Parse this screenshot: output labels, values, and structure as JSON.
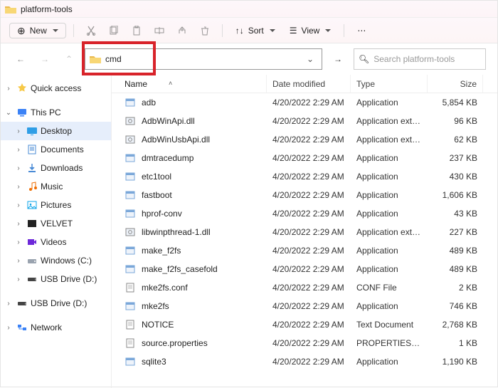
{
  "title": "platform-tools",
  "toolbar": {
    "new": "New",
    "sort": "Sort",
    "view": "View"
  },
  "address": {
    "value": "cmd",
    "search_placeholder": "Search platform-tools"
  },
  "columns": {
    "name": "Name",
    "date": "Date modified",
    "type": "Type",
    "size": "Size"
  },
  "sidebar": [
    {
      "id": "quick",
      "label": "Quick access",
      "icon": "star",
      "expand": ">",
      "indent": 0
    },
    {
      "id": "thispc",
      "label": "This PC",
      "icon": "pc",
      "expand": "v",
      "indent": 0,
      "gapBefore": true
    },
    {
      "id": "desktop",
      "label": "Desktop",
      "icon": "desktop",
      "expand": ">",
      "indent": 1,
      "selected": true
    },
    {
      "id": "documents",
      "label": "Documents",
      "icon": "doc",
      "expand": ">",
      "indent": 1
    },
    {
      "id": "downloads",
      "label": "Downloads",
      "icon": "down",
      "expand": ">",
      "indent": 1
    },
    {
      "id": "music",
      "label": "Music",
      "icon": "music",
      "expand": ">",
      "indent": 1
    },
    {
      "id": "pictures",
      "label": "Pictures",
      "icon": "pic",
      "expand": ">",
      "indent": 1
    },
    {
      "id": "velvet",
      "label": "VELVET",
      "icon": "vel",
      "expand": ">",
      "indent": 1
    },
    {
      "id": "videos",
      "label": "Videos",
      "icon": "vid",
      "expand": ">",
      "indent": 1
    },
    {
      "id": "cdrive",
      "label": "Windows (C:)",
      "icon": "drive",
      "expand": ">",
      "indent": 1
    },
    {
      "id": "usb1",
      "label": "USB Drive (D:)",
      "icon": "usb",
      "expand": ">",
      "indent": 1
    },
    {
      "id": "usb2",
      "label": "USB Drive (D:)",
      "icon": "usb",
      "expand": ">",
      "indent": 0,
      "gapBefore": true
    },
    {
      "id": "network",
      "label": "Network",
      "icon": "net",
      "expand": ">",
      "indent": 0,
      "gapBefore": true
    }
  ],
  "files": [
    {
      "name": "adb",
      "date": "4/20/2022 2:29 AM",
      "type": "Application",
      "size": "5,854 KB",
      "icon": "app"
    },
    {
      "name": "AdbWinApi.dll",
      "date": "4/20/2022 2:29 AM",
      "type": "Application exten...",
      "size": "96 KB",
      "icon": "gear"
    },
    {
      "name": "AdbWinUsbApi.dll",
      "date": "4/20/2022 2:29 AM",
      "type": "Application exten...",
      "size": "62 KB",
      "icon": "gear"
    },
    {
      "name": "dmtracedump",
      "date": "4/20/2022 2:29 AM",
      "type": "Application",
      "size": "237 KB",
      "icon": "app"
    },
    {
      "name": "etc1tool",
      "date": "4/20/2022 2:29 AM",
      "type": "Application",
      "size": "430 KB",
      "icon": "app"
    },
    {
      "name": "fastboot",
      "date": "4/20/2022 2:29 AM",
      "type": "Application",
      "size": "1,606 KB",
      "icon": "app"
    },
    {
      "name": "hprof-conv",
      "date": "4/20/2022 2:29 AM",
      "type": "Application",
      "size": "43 KB",
      "icon": "app"
    },
    {
      "name": "libwinpthread-1.dll",
      "date": "4/20/2022 2:29 AM",
      "type": "Application exten...",
      "size": "227 KB",
      "icon": "gear"
    },
    {
      "name": "make_f2fs",
      "date": "4/20/2022 2:29 AM",
      "type": "Application",
      "size": "489 KB",
      "icon": "app"
    },
    {
      "name": "make_f2fs_casefold",
      "date": "4/20/2022 2:29 AM",
      "type": "Application",
      "size": "489 KB",
      "icon": "app"
    },
    {
      "name": "mke2fs.conf",
      "date": "4/20/2022 2:29 AM",
      "type": "CONF File",
      "size": "2 KB",
      "icon": "doc"
    },
    {
      "name": "mke2fs",
      "date": "4/20/2022 2:29 AM",
      "type": "Application",
      "size": "746 KB",
      "icon": "app"
    },
    {
      "name": "NOTICE",
      "date": "4/20/2022 2:29 AM",
      "type": "Text Document",
      "size": "2,768 KB",
      "icon": "doc"
    },
    {
      "name": "source.properties",
      "date": "4/20/2022 2:29 AM",
      "type": "PROPERTIES File",
      "size": "1 KB",
      "icon": "doc"
    },
    {
      "name": "sqlite3",
      "date": "4/20/2022 2:29 AM",
      "type": "Application",
      "size": "1,190 KB",
      "icon": "app"
    }
  ]
}
